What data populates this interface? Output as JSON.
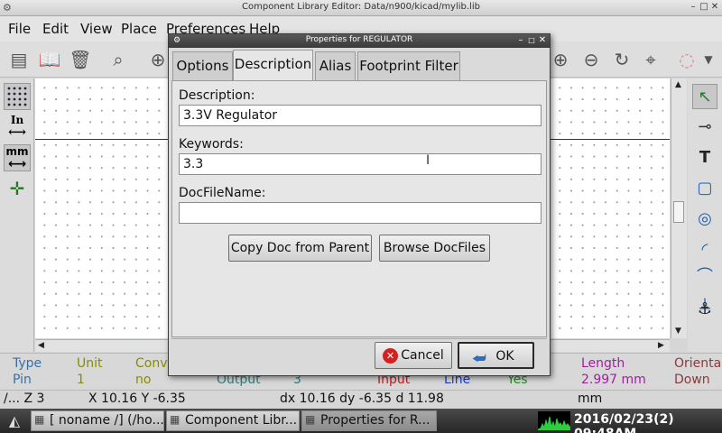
{
  "window": {
    "title": "Component Library Editor: Data/n900/kicad/mylib.lib"
  },
  "menubar": {
    "items": [
      "File",
      "Edit",
      "View",
      "Place",
      "Preferences",
      "Help"
    ]
  },
  "left_toolbar": {
    "grid_label": "",
    "inches_label": "In",
    "mm_label": "mm"
  },
  "message_panel": {
    "columns": [
      {
        "header": "Type",
        "value": "Pin",
        "header_color": "#3a6ea5",
        "value_color": "#3a6ea5"
      },
      {
        "header": "Unit",
        "value": "1",
        "header_color": "#8b8b00",
        "value_color": "#8b8b00"
      },
      {
        "header": "Conv",
        "value": "no",
        "header_color": "#8b8b00",
        "value_color": "#8b8b00"
      },
      {
        "header": "",
        "value": "Output",
        "header_color": "#2e7d7d",
        "value_color": "#2e7d7d"
      },
      {
        "header": "",
        "value": "3",
        "header_color": "#2e7d7d",
        "value_color": "#2e7d7d"
      },
      {
        "header": "",
        "value": "Input",
        "header_color": "#c02020",
        "value_color": "#c02020"
      },
      {
        "header": "",
        "value": "Line",
        "header_color": "#2040c0",
        "value_color": "#2040c0"
      },
      {
        "header": "",
        "value": "Yes",
        "header_color": "#2e8b2e",
        "value_color": "#2e8b2e"
      },
      {
        "header": "Length",
        "value": "2.997 mm",
        "header_color": "#a020a0",
        "value_color": "#a020a0"
      },
      {
        "header": "Orienta",
        "value": "Down",
        "header_color": "#8b3a3a",
        "value_color": "#8b3a3a"
      }
    ]
  },
  "statusbar": {
    "zoom": "/... Z 3",
    "xy": "X 10.16  Y -6.35",
    "delta": "dx 10.16  dy -6.35  d 11.98",
    "units": "mm"
  },
  "taskbar": {
    "tasks": [
      "[ noname /] (/ho...",
      "Component Libr...",
      "Properties for R..."
    ],
    "clock": "2016/02/23(2) 09:48AM"
  },
  "dialog": {
    "title": "Properties for REGULATOR",
    "tabs": [
      "Options",
      "Description",
      "Alias",
      "Footprint Filter"
    ],
    "active_tab": "Description",
    "fields": {
      "description_label": "Description:",
      "description_value": "3.3V Regulator",
      "keywords_label": "Keywords:",
      "keywords_value": "3.3",
      "docfile_label": "DocFileName:",
      "docfile_value": ""
    },
    "buttons": {
      "copy_doc": "Copy Doc from Parent",
      "browse_docs": "Browse DocFiles",
      "cancel": "Cancel",
      "ok": "OK"
    }
  }
}
